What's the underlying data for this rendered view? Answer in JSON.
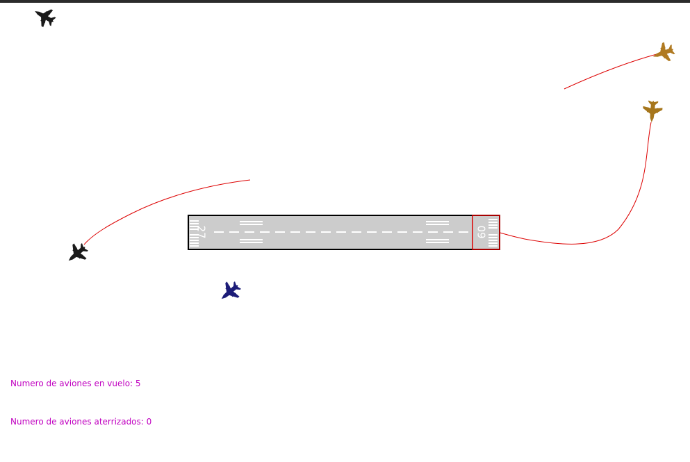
{
  "runway": {
    "left_number": "27",
    "right_number": "09"
  },
  "aircraft": [
    {
      "name": "aircraft-black-1",
      "color": "#1a1a1a"
    },
    {
      "name": "aircraft-black-2",
      "color": "#1a1a1a"
    },
    {
      "name": "aircraft-blue",
      "color": "#1c1c78"
    },
    {
      "name": "aircraft-tan-1",
      "color": "#b07a22"
    },
    {
      "name": "aircraft-tan-2",
      "color": "#a6761c"
    }
  ],
  "colors": {
    "path": "#dd0000",
    "hud_text": "#c000c0",
    "runway": "#cccccc",
    "landing_zone": "#dd0000"
  },
  "hud": {
    "in_flight_label": "Numero de aviones en vuelo:",
    "in_flight_count": "5",
    "landed_label": "Numero de aviones aterrizados:",
    "landed_count": "0"
  }
}
